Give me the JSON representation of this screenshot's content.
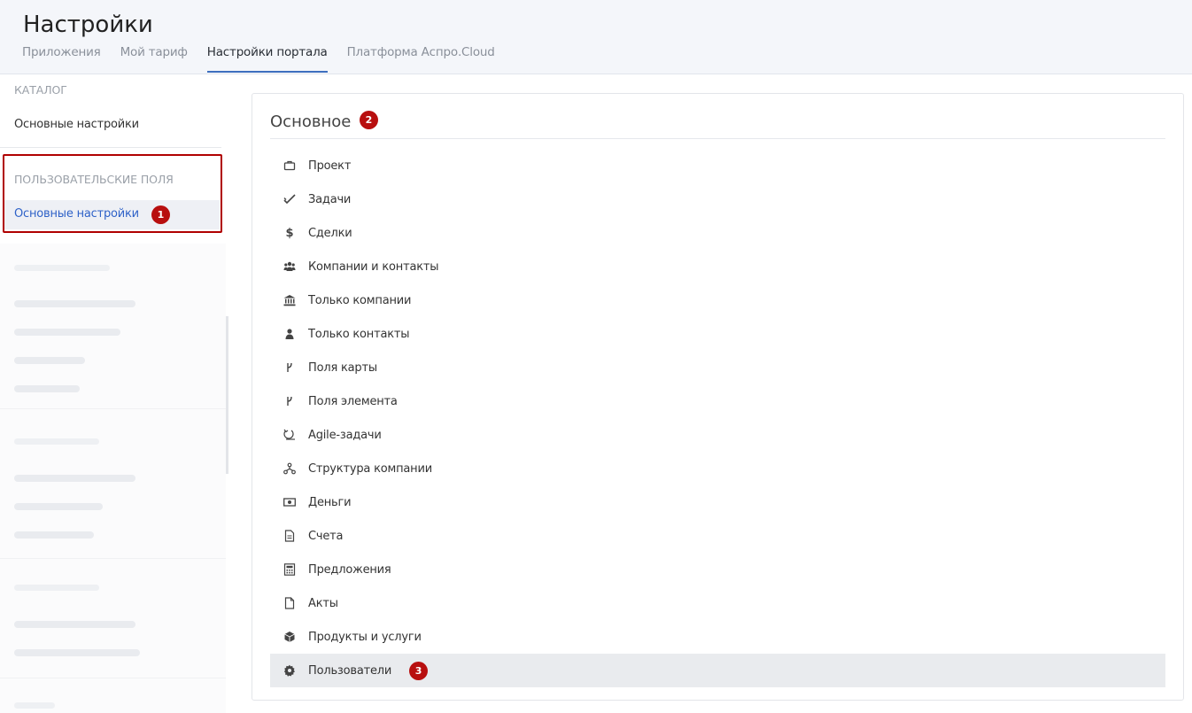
{
  "header": {
    "title": "Настройки",
    "tabs": [
      "Приложения",
      "Мой тариф",
      "Настройки портала",
      "Платформа Аспро.Cloud"
    ],
    "active_tab": "Настройки портала"
  },
  "sidebar": {
    "catalog_title": "КАТАЛОГ",
    "catalog_item": "Основные настройки",
    "custom_fields_title": "ПОЛЬЗОВАТЕЛЬСКИЕ ПОЛЯ",
    "custom_fields_item": "Основные настройки",
    "custom_fields_badge": "1"
  },
  "main": {
    "title": "Основное",
    "title_badge": "2",
    "items": [
      {
        "label": "Проект",
        "icon": "briefcase-icon"
      },
      {
        "label": "Задачи",
        "icon": "check-icon"
      },
      {
        "label": "Сделки",
        "icon": "dollar-icon"
      },
      {
        "label": "Компании и контакты",
        "icon": "users-icon"
      },
      {
        "label": "Только компании",
        "icon": "bank-icon"
      },
      {
        "label": "Только контакты",
        "icon": "user-icon"
      },
      {
        "label": "Поля карты",
        "icon": "branch-icon"
      },
      {
        "label": "Поля элемента",
        "icon": "branch-icon"
      },
      {
        "label": "Agile-задачи",
        "icon": "agile-icon"
      },
      {
        "label": "Структура компании",
        "icon": "structure-icon"
      },
      {
        "label": "Деньги",
        "icon": "money-icon"
      },
      {
        "label": "Счета",
        "icon": "document-icon"
      },
      {
        "label": "Предложения",
        "icon": "calculator-icon"
      },
      {
        "label": "Акты",
        "icon": "file-icon"
      },
      {
        "label": "Продукты и услуги",
        "icon": "box-icon"
      },
      {
        "label": "Пользователи",
        "icon": "gear-icon"
      }
    ],
    "selected_item": "Пользователи",
    "selected_badge": "3"
  },
  "colors": {
    "accent": "#3d6fbf",
    "badge": "#b80f0f",
    "highlight_border": "#b00000",
    "active_link": "#2f62c8"
  }
}
